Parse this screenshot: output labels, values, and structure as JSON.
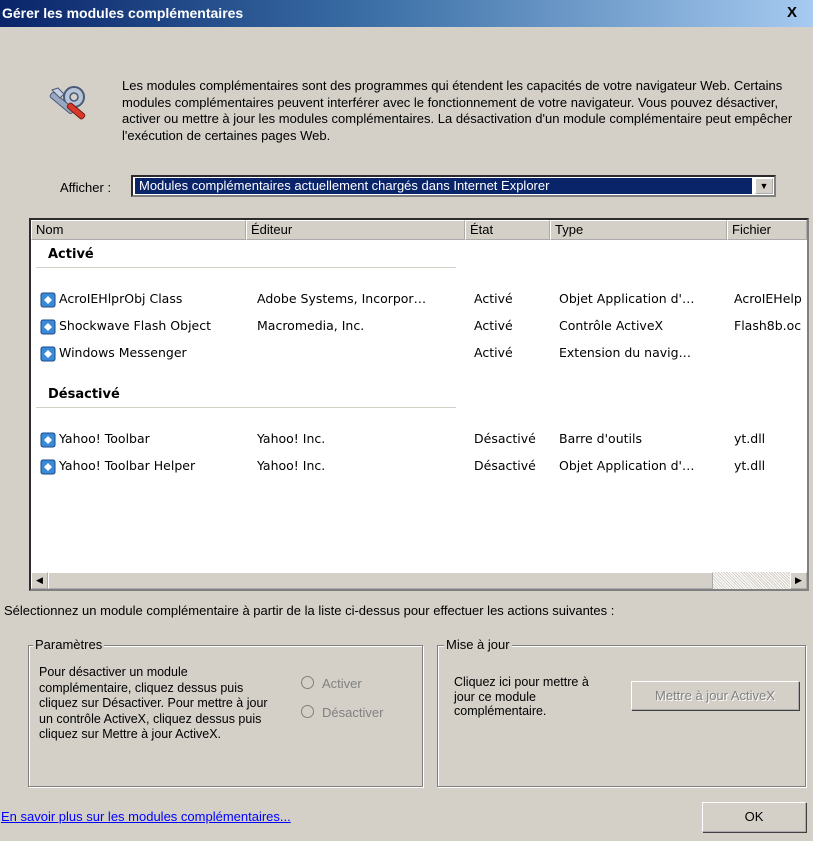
{
  "window": {
    "title": "Gérer les modules complémentaires",
    "close_label": "X"
  },
  "intro": {
    "icon": "tools-icon",
    "text": "Les modules complémentaires sont des programmes qui étendent les capacités de votre navigateur Web. Certains modules complémentaires peuvent interférer avec le fonctionnement de votre navigateur. Vous pouvez désactiver, activer ou mettre à jour les modules complémentaires. La désactivation d'un module complémentaire peut empêcher l'exécution de certaines pages Web."
  },
  "filter": {
    "label": "Afficher :",
    "selected": "Modules complémentaires actuellement chargés dans Internet Explorer"
  },
  "list": {
    "columns": [
      "Nom",
      "Éditeur",
      "État",
      "Type",
      "Fichier"
    ],
    "groups": [
      {
        "label": "Activé",
        "rows": [
          {
            "nom": "AcroIEHlprObj Class",
            "editeur": "Adobe Systems, Incorpor…",
            "etat": "Activé",
            "type": "Objet Application d'…",
            "fichier": "AcroIEHelp"
          },
          {
            "nom": "Shockwave Flash Object",
            "editeur": "Macromedia, Inc.",
            "etat": "Activé",
            "type": "Contrôle ActiveX",
            "fichier": "Flash8b.oc"
          },
          {
            "nom": "Windows Messenger",
            "editeur": "",
            "etat": "Activé",
            "type": "Extension du navig…",
            "fichier": ""
          }
        ]
      },
      {
        "label": "Désactivé",
        "rows": [
          {
            "nom": "Yahoo! Toolbar",
            "editeur": "Yahoo! Inc.",
            "etat": "Désactivé",
            "type": "Barre d'outils",
            "fichier": "yt.dll"
          },
          {
            "nom": "Yahoo! Toolbar Helper",
            "editeur": "Yahoo! Inc.",
            "etat": "Désactivé",
            "type": "Objet Application d'…",
            "fichier": "yt.dll"
          }
        ]
      }
    ]
  },
  "hint": "Sélectionnez un module complémentaire à partir de la liste ci-dessus pour effectuer les actions suivantes :",
  "parametres": {
    "legend": "Paramètres",
    "text": "Pour désactiver un module complémentaire, cliquez dessus puis cliquez sur Désactiver. Pour mettre à jour un contrôle ActiveX, cliquez dessus puis cliquez sur Mettre à jour ActiveX.",
    "radio_activer": "Activer",
    "radio_desactiver": "Désactiver"
  },
  "mise_a_jour": {
    "legend": "Mise à jour",
    "text": "Cliquez ici pour mettre à jour ce module complémentaire.",
    "button": "Mettre à jour ActiveX"
  },
  "footer": {
    "link": "En savoir plus sur les modules complémentaires...",
    "ok": "OK"
  },
  "colors": {
    "title_start": "#0a246a",
    "title_end": "#a6caf0",
    "dialog_bg": "#d4d0c8",
    "selection": "#0a246a",
    "link": "#0000ff"
  }
}
